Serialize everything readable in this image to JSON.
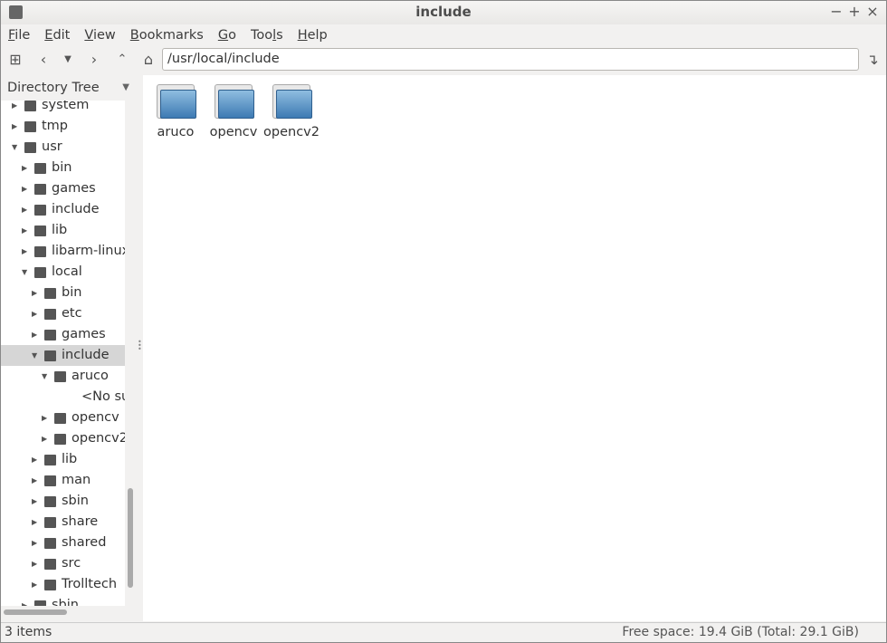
{
  "window": {
    "title": "include",
    "controls": [
      "−",
      "+",
      "×"
    ]
  },
  "menu": [
    {
      "u": "F",
      "rest": "ile"
    },
    {
      "u": "E",
      "rest": "dit"
    },
    {
      "u": "V",
      "rest": "iew"
    },
    {
      "u": "B",
      "rest": "ookmarks"
    },
    {
      "u": "G",
      "rest": "o"
    },
    {
      "pre": "Too",
      "u": "l",
      "rest": "s"
    },
    {
      "u": "H",
      "rest": "elp"
    }
  ],
  "toolbar": {
    "address": "/usr/local/include"
  },
  "sidebar": {
    "title": "Directory Tree",
    "items": [
      {
        "label": "system",
        "level": 0,
        "state": "collapsed"
      },
      {
        "label": "tmp",
        "level": 0,
        "state": "collapsed"
      },
      {
        "label": "usr",
        "level": 0,
        "state": "expanded"
      },
      {
        "label": "bin",
        "level": 1,
        "state": "collapsed"
      },
      {
        "label": "games",
        "level": 1,
        "state": "collapsed"
      },
      {
        "label": "include",
        "level": 1,
        "state": "collapsed"
      },
      {
        "label": "lib",
        "level": 1,
        "state": "collapsed"
      },
      {
        "label": "libarm-linux",
        "level": 1,
        "state": "collapsed"
      },
      {
        "label": "local",
        "level": 1,
        "state": "expanded"
      },
      {
        "label": "bin",
        "level": 2,
        "state": "collapsed"
      },
      {
        "label": "etc",
        "level": 2,
        "state": "collapsed"
      },
      {
        "label": "games",
        "level": 2,
        "state": "collapsed"
      },
      {
        "label": "include",
        "level": 2,
        "state": "expanded",
        "selected": true
      },
      {
        "label": "aruco",
        "level": 3,
        "state": "expanded"
      },
      {
        "label": "<No su",
        "level": 4,
        "state": "none"
      },
      {
        "label": "opencv",
        "level": 3,
        "state": "collapsed"
      },
      {
        "label": "opencv2",
        "level": 3,
        "state": "collapsed"
      },
      {
        "label": "lib",
        "level": 2,
        "state": "collapsed"
      },
      {
        "label": "man",
        "level": 2,
        "state": "collapsed"
      },
      {
        "label": "sbin",
        "level": 2,
        "state": "collapsed"
      },
      {
        "label": "share",
        "level": 2,
        "state": "collapsed"
      },
      {
        "label": "shared",
        "level": 2,
        "state": "collapsed"
      },
      {
        "label": "src",
        "level": 2,
        "state": "collapsed"
      },
      {
        "label": "Trolltech",
        "level": 2,
        "state": "collapsed"
      },
      {
        "label": "sbin",
        "level": 1,
        "state": "collapsed"
      }
    ]
  },
  "files": [
    {
      "name": "aruco"
    },
    {
      "name": "opencv"
    },
    {
      "name": "opencv2"
    }
  ],
  "status": {
    "items": "3 items",
    "free": "Free space: 19.4 GiB (Total: 29.1 GiB)"
  }
}
